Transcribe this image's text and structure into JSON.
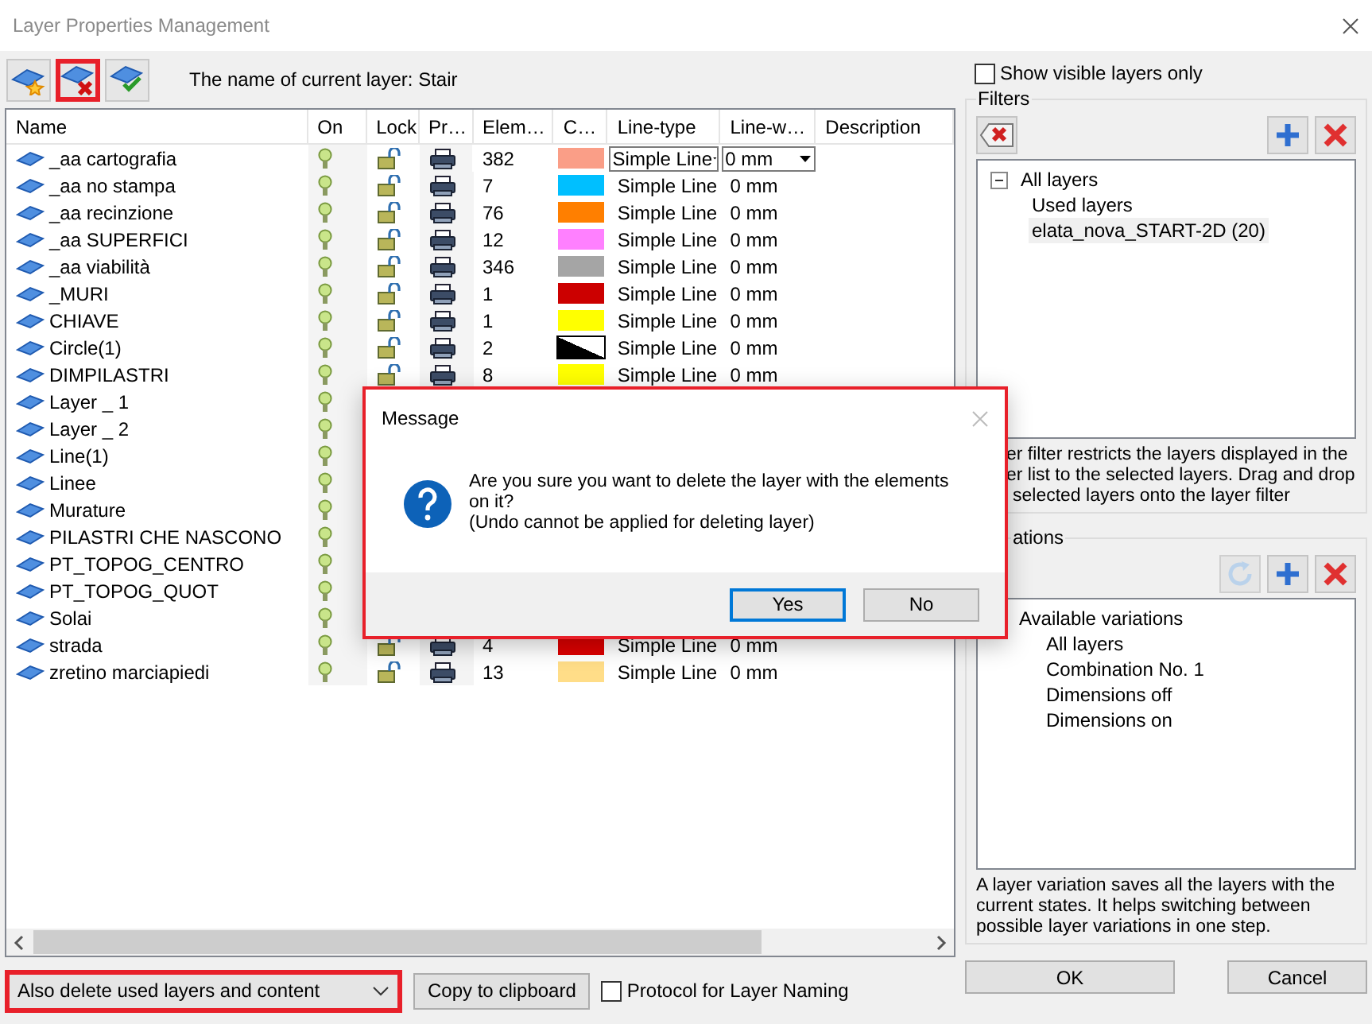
{
  "window": {
    "title": "Layer Properties Management"
  },
  "toolbar": {
    "tools": [
      {
        "kind": "new",
        "highlighted": false
      },
      {
        "kind": "delete",
        "highlighted": true
      },
      {
        "kind": "current",
        "highlighted": false
      }
    ],
    "current_layer_label": "The name of current layer: Stair"
  },
  "table": {
    "columns": [
      "Name",
      "On",
      "Lock",
      "Pr…",
      "Elem…",
      "C…",
      "Line-type",
      "Line-w…",
      "Description"
    ],
    "rows": [
      {
        "name": "_aa cartografia",
        "elements": "382",
        "color": "#fa9e87",
        "line_type": "Simple Line",
        "line_width": "0 mm",
        "editing": true
      },
      {
        "name": "_aa no stampa",
        "elements": "7",
        "color": "#00bfff",
        "line_type": "Simple Line",
        "line_width": "0 mm",
        "editing": false
      },
      {
        "name": "_aa recinzione",
        "elements": "76",
        "color": "#ff7f00",
        "line_type": "Simple Line",
        "line_width": "0 mm",
        "editing": false
      },
      {
        "name": "_aa SUPERFICI",
        "elements": "12",
        "color": "#ff80ff",
        "line_type": "Simple Line",
        "line_width": "0 mm",
        "editing": false
      },
      {
        "name": "_aa viabilità",
        "elements": "346",
        "color": "#a5a5a5",
        "line_type": "Simple Line",
        "line_width": "0 mm",
        "editing": false
      },
      {
        "name": "_MURI",
        "elements": "1",
        "color": "#cc0000",
        "line_type": "Simple Line",
        "line_width": "0 mm",
        "editing": false
      },
      {
        "name": "CHIAVE",
        "elements": "1",
        "color": "#ffff00",
        "line_type": "Simple Line",
        "line_width": "0 mm",
        "editing": false
      },
      {
        "name": "Circle(1)",
        "elements": "2",
        "color": "#000000",
        "split": true,
        "line_type": "Simple Line",
        "line_width": "0 mm",
        "editing": false
      },
      {
        "name": "DIMPILASTRI",
        "elements": "8",
        "color": "#ffff00",
        "line_type": "Simple Line",
        "line_width": "0 mm",
        "editing": false
      },
      {
        "name": "Layer _ 1"
      },
      {
        "name": "Layer _ 2"
      },
      {
        "name": "Line(1)"
      },
      {
        "name": "Linee"
      },
      {
        "name": "Murature"
      },
      {
        "name": "PILASTRI CHE NASCONO"
      },
      {
        "name": "PT_TOPOG_CENTRO"
      },
      {
        "name": "PT_TOPOG_QUOT"
      },
      {
        "name": "Solai"
      },
      {
        "name": "strada",
        "elements": "4",
        "color": "#dd0000",
        "line_type": "Simple Line",
        "line_width": "0 mm",
        "editing": false
      },
      {
        "name": "zretino marciapiedi",
        "elements": "13",
        "color": "#ffdd88",
        "line_type": "Simple Line",
        "line_width": "0 mm",
        "editing": false
      }
    ]
  },
  "bottom": {
    "delete_mode": {
      "value": "Also delete used layers and content",
      "highlighted": true
    },
    "copy_button": "Copy to clipboard",
    "protocol": {
      "label": "Protocol for Layer Naming",
      "checked": false
    }
  },
  "right": {
    "show_visible": {
      "label": "Show visible layers only",
      "checked": false
    },
    "filters": {
      "title": "Filters",
      "tools": [
        {
          "kind": "clear",
          "disabled": false
        },
        {
          "kind": "add",
          "disabled": false
        },
        {
          "kind": "delete",
          "disabled": false
        }
      ],
      "tree": [
        {
          "label": "All layers",
          "expanded": true,
          "selected": false,
          "children": [
            {
              "label": "Used layers",
              "selected": false
            },
            {
              "label": "elata_nova_START-2D (20)",
              "selected": true
            }
          ]
        }
      ],
      "hint": [
        "er filter restricts the layers displayed in the",
        "er list to the selected layers. Drag and drop",
        "selected layers onto the layer filter"
      ]
    },
    "variations": {
      "title": "ations",
      "tools": [
        {
          "kind": "refresh",
          "disabled": true
        },
        {
          "kind": "add",
          "disabled": false
        },
        {
          "kind": "delete",
          "disabled": false
        }
      ],
      "tree": [
        {
          "label": "Available variations",
          "children": [
            {
              "label": "All layers"
            },
            {
              "label": "Combination No. 1"
            },
            {
              "label": "Dimensions off"
            },
            {
              "label": "Dimensions on"
            }
          ]
        }
      ],
      "hint": "A layer variation saves all the layers with the current states. It helps switching between possible layer variations in one step."
    },
    "ok": "OK",
    "cancel": "Cancel"
  },
  "dialog": {
    "title": "Message",
    "message": [
      "Are you sure you want to delete the layer with the elements",
      "on it?",
      "(Undo cannot be applied for deleting layer)"
    ],
    "buttons": [
      {
        "label": "Yes",
        "default": true
      },
      {
        "label": "No",
        "default": false
      }
    ]
  }
}
